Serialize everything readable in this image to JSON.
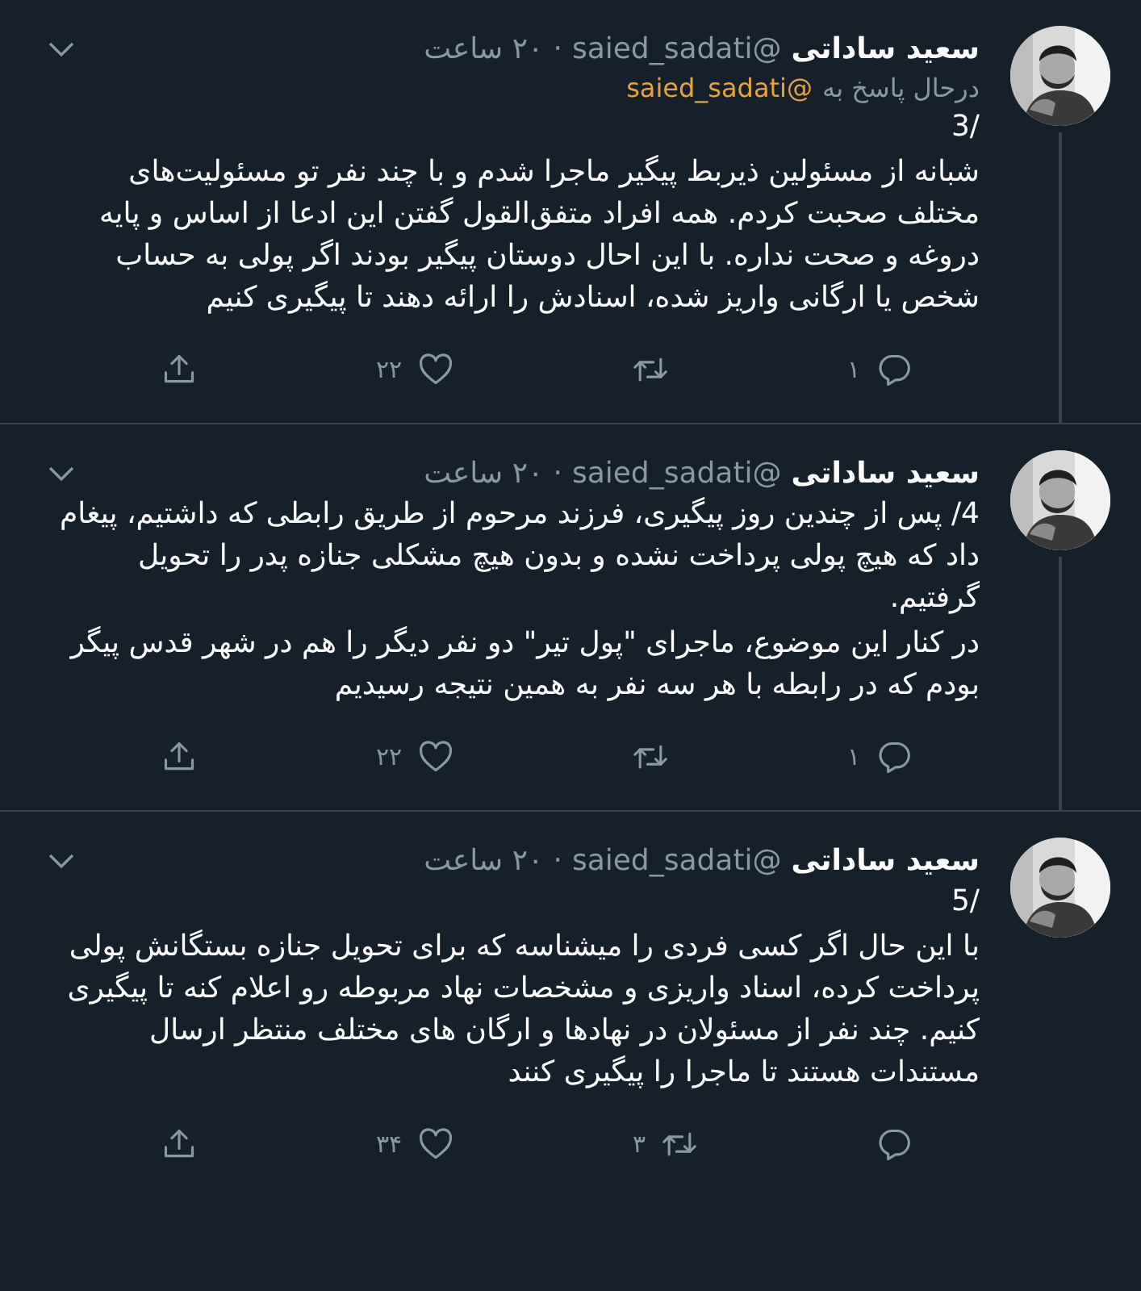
{
  "tweets": [
    {
      "author": "سعید ساداتی",
      "handle": "@saied_sadati",
      "separator": "·",
      "time": "۲۰ ساعت",
      "replying_to": {
        "label": "درحال پاسخ به",
        "handle": "@saied_sadati"
      },
      "thread_continues": true,
      "paragraphs": [
        "3/",
        "شبانه از مسئولین ذیربط پیگیر ماجرا شدم و با چند نفر تو مسئولیت‌های مختلف صحبت کردم. همه افراد متفق‌القول گفتن این ادعا از اساس و پایه دروغه و صحت نداره. با این احال دوستان پیگیر بودند اگر پولی به حساب شخص یا ارگانی واریز شده، اسنادش را ارائه دهند تا پیگیری کنیم"
      ],
      "actions": [
        {
          "kind": "reply",
          "count": "۱"
        },
        {
          "kind": "retweet"
        },
        {
          "kind": "like",
          "count": "۲۲"
        },
        {
          "kind": "share"
        }
      ]
    },
    {
      "author": "سعید ساداتی",
      "handle": "@saied_sadati",
      "separator": "·",
      "time": "۲۰ ساعت",
      "thread_continues": true,
      "paragraphs": [
        "4/ پس از چندین روز پیگیری، فرزند مرحوم از طریق رابطی که داشتیم، پیغام داد که هیچ پولی پرداخت نشده و بدون هیچ مشکلی جنازه پدر را تحویل گرفتیم.",
        "در کنار این موضوع، ماجرای \"پول تیر\" دو نفر دیگر را هم در شهر قدس پیگر بودم که در رابطه با هر سه نفر به همین نتیجه رسیدیم"
      ],
      "actions": [
        {
          "kind": "reply",
          "count": "۱"
        },
        {
          "kind": "retweet"
        },
        {
          "kind": "like",
          "count": "۲۲"
        },
        {
          "kind": "share"
        }
      ]
    },
    {
      "author": "سعید ساداتی",
      "handle": "@saied_sadati",
      "separator": "·",
      "time": "۲۰ ساعت",
      "thread_continues": false,
      "paragraphs": [
        "5/",
        "با این حال اگر کسی فردی را میشناسه که برای تحویل جنازه بستگانش پولی پرداخت کرده، اسناد واریزی و مشخصات نهاد مربوطه رو اعلام کنه تا پیگیری کنیم. چند نفر از مسئولان در نهادها و ارگان های مختلف منتظر ارسال مستندات هستند تا ماجرا را پیگیری کنند"
      ],
      "actions": [
        {
          "kind": "reply"
        },
        {
          "kind": "retweet",
          "count": "۳"
        },
        {
          "kind": "like",
          "count": "۳۴"
        },
        {
          "kind": "share"
        }
      ]
    }
  ]
}
